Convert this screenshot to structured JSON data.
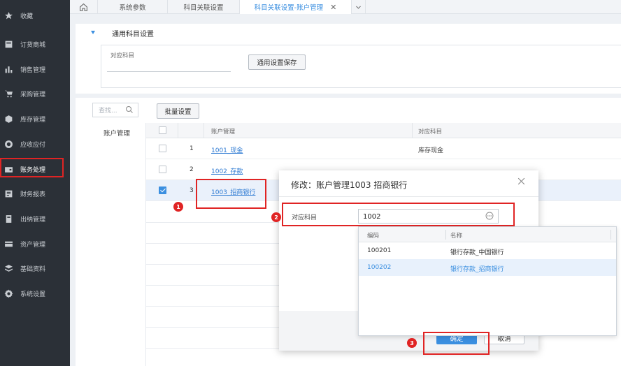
{
  "sidebar": {
    "items": [
      {
        "label": "收藏",
        "icon": "star-icon"
      },
      {
        "label": "订货商城",
        "icon": "shop-icon"
      },
      {
        "label": "销售管理",
        "icon": "bar-chart-icon"
      },
      {
        "label": "采购管理",
        "icon": "cart-icon"
      },
      {
        "label": "库存管理",
        "icon": "box-icon"
      },
      {
        "label": "应收应付",
        "icon": "coin-icon"
      },
      {
        "label": "账务处理",
        "icon": "wallet-icon"
      },
      {
        "label": "财务报表",
        "icon": "report-icon"
      },
      {
        "label": "出纳管理",
        "icon": "cashier-icon"
      },
      {
        "label": "资产管理",
        "icon": "asset-icon"
      },
      {
        "label": "基础资料",
        "icon": "layers-icon"
      },
      {
        "label": "系统设置",
        "icon": "gear-icon"
      }
    ],
    "active_index": 6
  },
  "tabs": [
    {
      "label": "系统参数"
    },
    {
      "label": "科目关联设置"
    },
    {
      "label": "科目关联设置-账户管理",
      "active": true
    }
  ],
  "general": {
    "section_title": "通用科目设置",
    "field_label": "对应科目",
    "save_button": "通用设置保存"
  },
  "left": {
    "search_placeholder": "查找...",
    "category": "账户管理"
  },
  "toolbar": {
    "batch_button": "批量设置"
  },
  "table": {
    "headers": {
      "account": "账户管理",
      "subject": "对应科目"
    },
    "rows": [
      {
        "num": "1",
        "account": "1001_现金",
        "subject": "库存现金",
        "checked": false
      },
      {
        "num": "2",
        "account": "1002_存款",
        "subject": "",
        "checked": false
      },
      {
        "num": "3",
        "account": "1003_招商银行",
        "subject": "",
        "checked": true
      }
    ]
  },
  "modal": {
    "title": "修改：账户管理1003 招商银行",
    "field_label": "对应科目",
    "field_value": "1002",
    "confirm": "确定",
    "cancel": "取消"
  },
  "dropdown": {
    "headers": {
      "code": "编码",
      "name": "名称"
    },
    "rows": [
      {
        "code": "100201",
        "name": "银行存款_中国银行",
        "highlighted": false
      },
      {
        "code": "100202",
        "name": "银行存款_招商银行",
        "highlighted": true
      }
    ]
  },
  "annotations": [
    "1",
    "2",
    "3"
  ],
  "colors": {
    "sidebar_bg": "#2b3037",
    "accent": "#3b8fe0",
    "highlight_box": "#e02424",
    "link": "#2f7bd3"
  }
}
